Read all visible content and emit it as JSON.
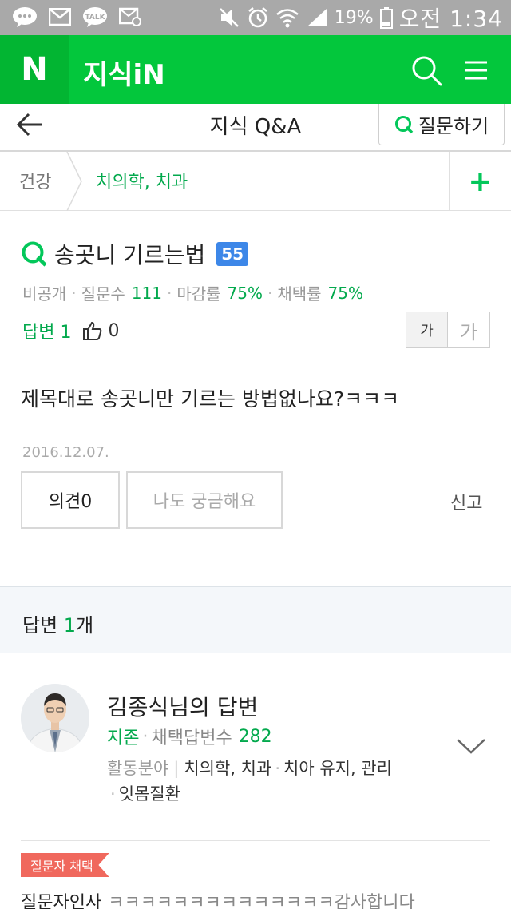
{
  "status_bar": {
    "battery": "19%",
    "time": "오전 1:34",
    "talk_label": "TALK"
  },
  "header": {
    "logo": "N",
    "title": "지식iN"
  },
  "subnav": {
    "title": "지식 Q&A",
    "ask_button": "질문하기"
  },
  "breadcrumb": {
    "root": "건강",
    "category": "치의학, 치과",
    "add": "+"
  },
  "question": {
    "title": "송곳니 기르는법",
    "badge": "55",
    "author": "비공개",
    "questions_label": "질문수",
    "questions_value": "111",
    "close_rate_label": "마감률",
    "close_rate_value": "75%",
    "choose_rate_label": "채택률",
    "choose_rate_value": "75%",
    "answers_label": "답변 1",
    "likes": "0",
    "font_small": "가",
    "font_large": "가",
    "body": "제목대로 송곳니만 기르는 방법없나요?ㅋㅋㅋ",
    "date": "2016.12.07.",
    "opinion_button": "의견0",
    "curious_button": "나도 궁금해요",
    "report": "신고"
  },
  "answers": {
    "header_prefix": "답변 ",
    "header_count": "1",
    "header_suffix": "개",
    "answerer": {
      "name": "김종식님의 답변",
      "level": "지존",
      "chosen_label": "채택답변수",
      "chosen_value": "282",
      "field_label": "활동분야",
      "field_1": "치의학, 치과",
      "field_2": "치아 유지, 관리",
      "field_3": "잇몸질환"
    },
    "chosen_tag": "질문자 채택",
    "thanks_label": "질문자인사",
    "thanks_message": "ㅋㅋㅋㅋㅋㅋㅋㅋㅋㅋㅋㅋㅋㅋ감사합니다"
  },
  "colors": {
    "naver_green": "#03c73c",
    "accent_green": "#03a94d",
    "badge_blue": "#3d87e8",
    "chosen_red": "#f0685d"
  }
}
